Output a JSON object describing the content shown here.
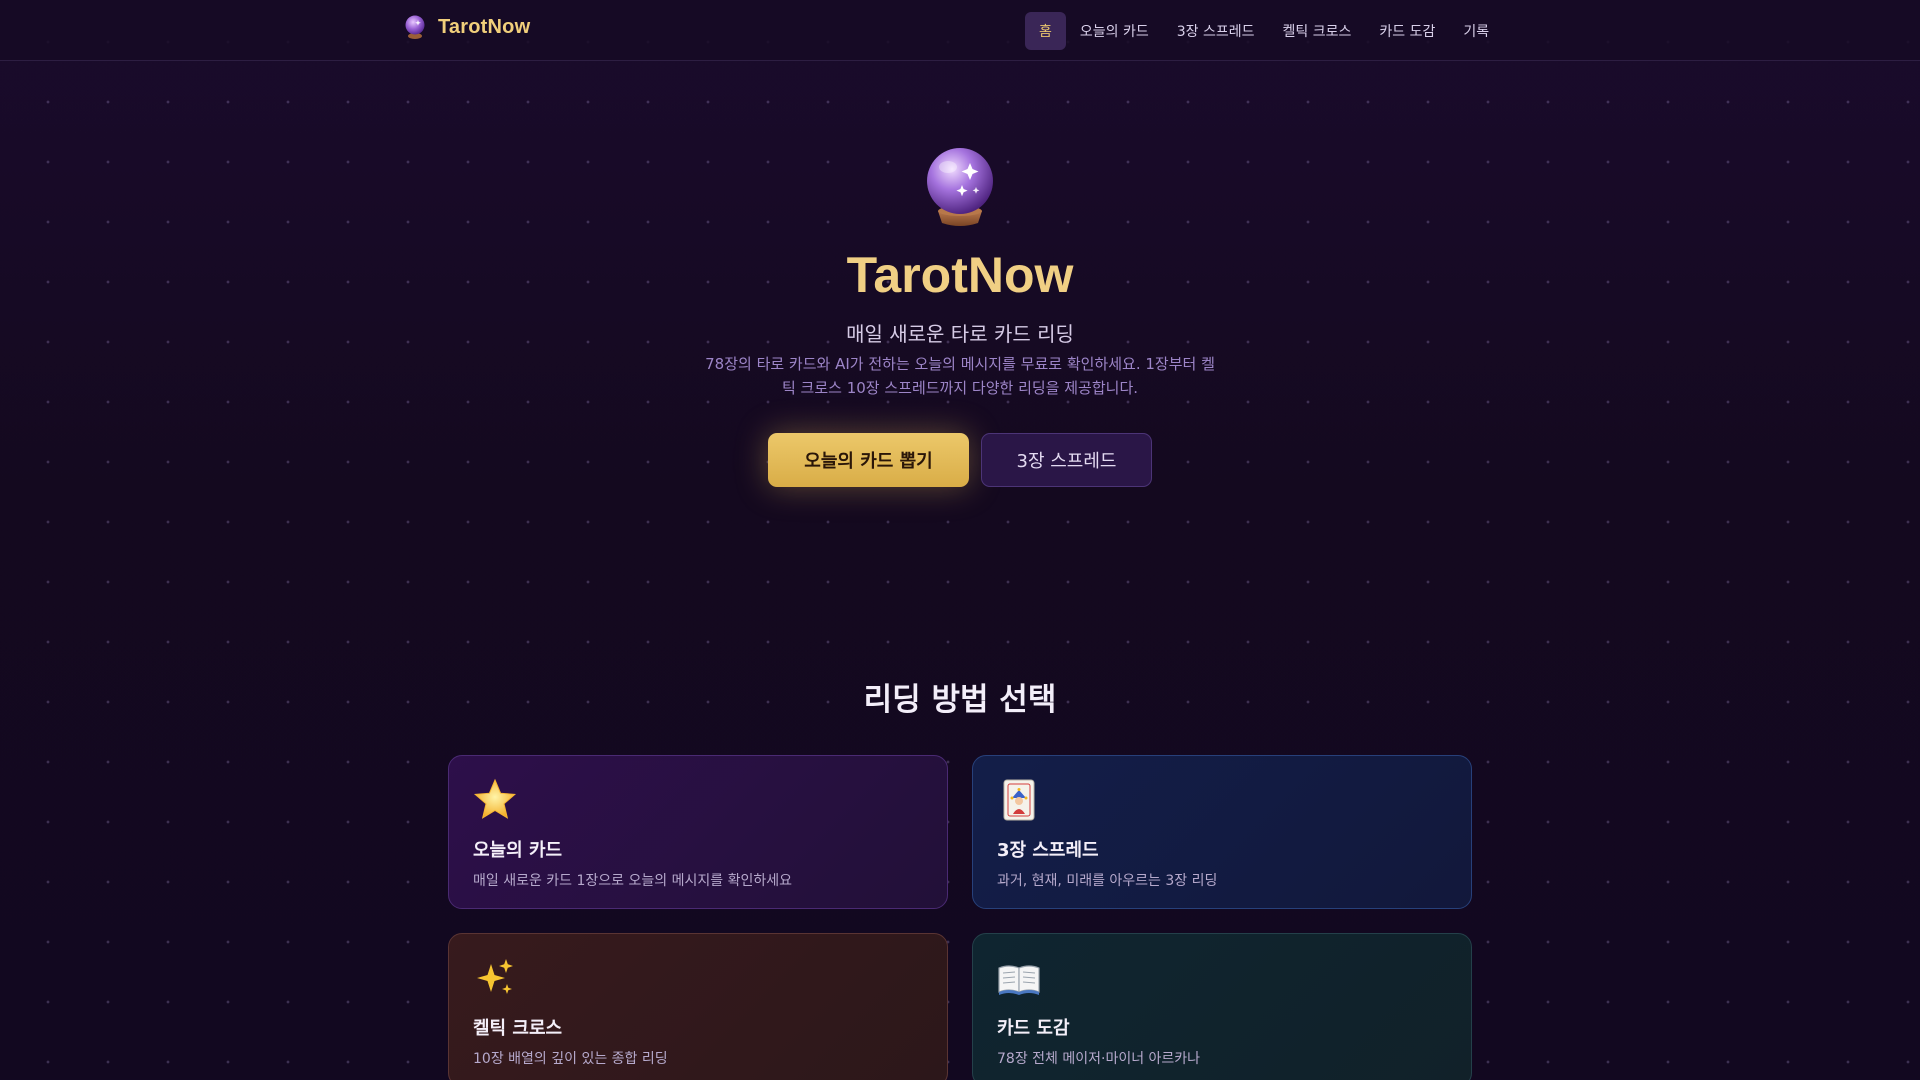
{
  "app": {
    "name": "TarotNow",
    "logo_icon": "crystal-ball-icon"
  },
  "nav": {
    "items": [
      {
        "label": "홈",
        "active": true
      },
      {
        "label": "오늘의 카드",
        "active": false
      },
      {
        "label": "3장 스프레드",
        "active": false
      },
      {
        "label": "켈틱 크로스",
        "active": false
      },
      {
        "label": "카드 도감",
        "active": false
      },
      {
        "label": "기록",
        "active": false
      }
    ]
  },
  "hero": {
    "icon": "crystal-ball-icon",
    "title": "TarotNow",
    "subtitle": "매일 새로운 타로 카드 리딩",
    "description": "78장의 타로 카드와 AI가 전하는 오늘의 메시지를 무료로 확인하세요. 1장부터 켈틱 크로스 10장 스프레드까지 다양한 리딩을 제공합니다.",
    "primary_button": "오늘의 카드 뽑기",
    "secondary_button": "3장 스프레드"
  },
  "methods": {
    "title": "리딩 방법 선택",
    "cards": [
      {
        "icon": "star-icon",
        "title": "오늘의 카드",
        "description": "매일 새로운 카드 1장으로 오늘의 메시지를 확인하세요"
      },
      {
        "icon": "joker-card-icon",
        "title": "3장 스프레드",
        "description": "과거, 현재, 미래를 아우르는 3장 리딩"
      },
      {
        "icon": "sparkles-icon",
        "title": "켈틱 크로스",
        "description": "10장 배열의 깊이 있는 종합 리딩"
      },
      {
        "icon": "open-book-icon",
        "title": "카드 도감",
        "description": "78장 전체 메이저·마이너 아르카나"
      }
    ]
  },
  "colors": {
    "accent_gold": "#f0cf84",
    "background": "#13081f",
    "nav_active_bg": "#3a2657"
  }
}
